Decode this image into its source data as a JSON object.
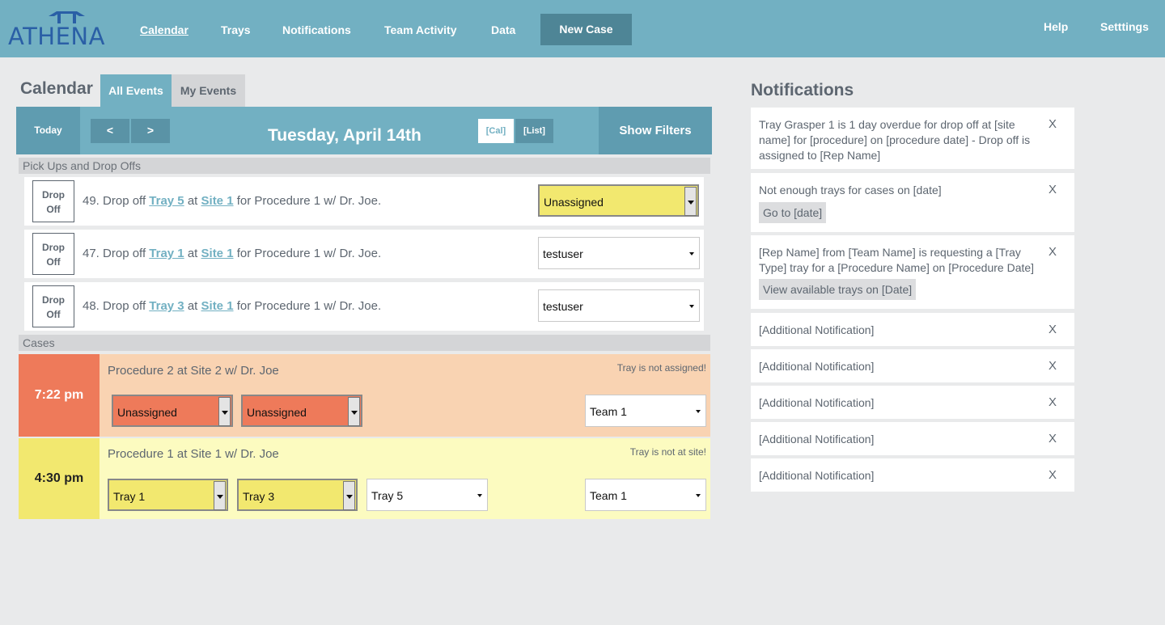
{
  "brand": {
    "logo_text": "ATHENA",
    "color": "#2a5fa6"
  },
  "nav": {
    "calendar": "Calendar",
    "trays": "Trays",
    "notifications": "Notifications",
    "team_activity": "Team Activity",
    "data": "Data",
    "new_case": "New Case",
    "help": "Help",
    "settings": "Setttings"
  },
  "calendar": {
    "title": "Calendar",
    "tabs": {
      "all": "All Events",
      "my": "My Events"
    },
    "today": "Today",
    "prev": "<",
    "next": ">",
    "date": "Tuesday, April 14th",
    "view_cal": "[Cal]",
    "view_list": "[List]",
    "filters": "Show Filters"
  },
  "pickups": {
    "header": "Pick Ups and Drop Offs",
    "items": [
      {
        "icon_line1": "Drop",
        "icon_line2": "Off",
        "num": "49. Drop off ",
        "tray": "Tray 5",
        "at": " at ",
        "site": "Site 1",
        "rest": " for Procedure 1 w/ Dr. Joe.",
        "assignee": "Unassigned",
        "highlight": true
      },
      {
        "icon_line1": "Drop",
        "icon_line2": "Off",
        "num": "47. Drop off ",
        "tray": "Tray 1",
        "at": " at ",
        "site": "Site 1",
        "rest": " for Procedure 1 w/ Dr. Joe.",
        "assignee": "testuser",
        "highlight": false
      },
      {
        "icon_line1": "Drop",
        "icon_line2": "Off",
        "num": "48. Drop off ",
        "tray": "Tray 3",
        "at": " at ",
        "site": "Site 1",
        "rest": " for Procedure 1 w/ Dr. Joe.",
        "assignee": "testuser",
        "highlight": false
      }
    ]
  },
  "cases": {
    "header": "Cases",
    "items": [
      {
        "time": "7:22 pm",
        "title": "Procedure 2 at Site 2 w/ Dr. Joe",
        "warning": "Tray is not assigned!",
        "tray_a": "Unassigned",
        "tray_b": "Unassigned",
        "team": "Team 1",
        "time_color": "#ee7a5a",
        "body_color": "#f9d3b2"
      },
      {
        "time": "4:30 pm",
        "title": "Procedure 1 at Site 1 w/ Dr. Joe",
        "warning": "Tray is not at site!",
        "tray_a": "Tray 1",
        "tray_b": "Tray 3",
        "tray_c": "Tray 5",
        "team": "Team 1",
        "time_color": "#f2e86f",
        "body_color": "#fcfbc0"
      }
    ]
  },
  "notifications": {
    "title": "Notifications",
    "close": "X",
    "items": [
      {
        "text": "Tray Grasper 1 is 1 day overdue for drop off at [site name] for [procedure] on [procedure date] - Drop off is assigned to [Rep Name]"
      },
      {
        "text": "Not enough trays for cases on [date]",
        "action": "Go to [date]"
      },
      {
        "text": "[Rep Name] from [Team Name] is requesting a [Tray Type] tray for a [Procedure Name] on [Procedure Date]",
        "action": "View available trays on [Date]"
      },
      {
        "text": "[Additional Notification]"
      },
      {
        "text": "[Additional Notification]"
      },
      {
        "text": "[Additional Notification]"
      },
      {
        "text": "[Additional Notification]"
      },
      {
        "text": "[Additional Notification]"
      }
    ]
  },
  "colors": {
    "primary": "#72b0c2",
    "dark": "#4e8596",
    "highlight_yellow": "#f2e86f",
    "alert_orange": "#ee7a5a"
  }
}
